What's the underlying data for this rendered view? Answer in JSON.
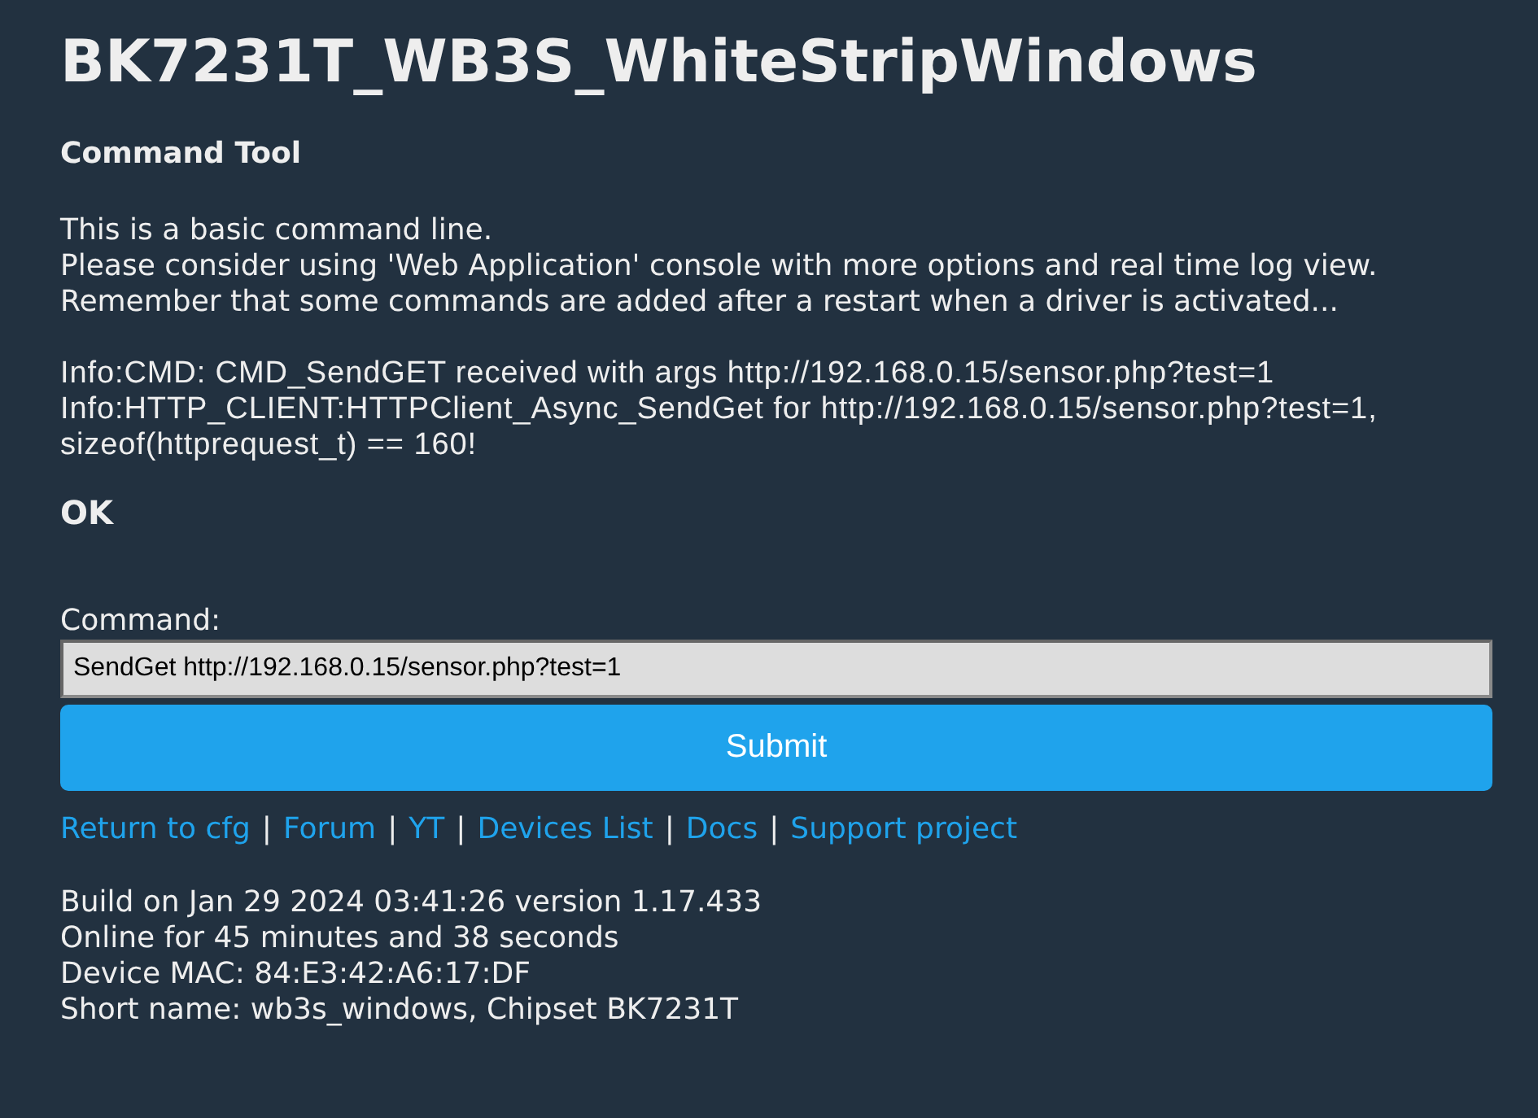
{
  "page": {
    "title": "BK7231T_WB3S_WhiteStripWindows",
    "heading": "Command Tool"
  },
  "intro": [
    "This is a basic command line.",
    "Please consider using 'Web Application' console with more options and real time log view.",
    "Remember that some commands are added after a restart when a driver is activated..."
  ],
  "log": [
    "Info:CMD: CMD_SendGET received with args http://192.168.0.15/sensor.php?test=1",
    "Info:HTTP_CLIENT:HTTPClient_Async_SendGet for http://192.168.0.15/sensor.php?test=1, sizeof(httprequest_t) == 160!"
  ],
  "result": "OK",
  "command_form": {
    "label": "Command:",
    "value": "SendGet http://192.168.0.15/sensor.php?test=1",
    "submit": "Submit"
  },
  "links": [
    {
      "label": "Return to cfg",
      "separator": "|"
    },
    {
      "label": "Forum",
      "separator": "|"
    },
    {
      "label": "YT",
      "separator": "|"
    },
    {
      "label": "Devices List",
      "separator": "|"
    },
    {
      "label": "Docs",
      "separator": "|"
    },
    {
      "label": "Support project"
    }
  ],
  "build_info": [
    "Build on Jan 29 2024 03:41:26 version 1.17.433",
    "Online for 45 minutes and 38 seconds",
    "Device MAC: 84:E3:42:A6:17:DF",
    "Short name: wb3s_windows, Chipset BK7231T"
  ]
}
